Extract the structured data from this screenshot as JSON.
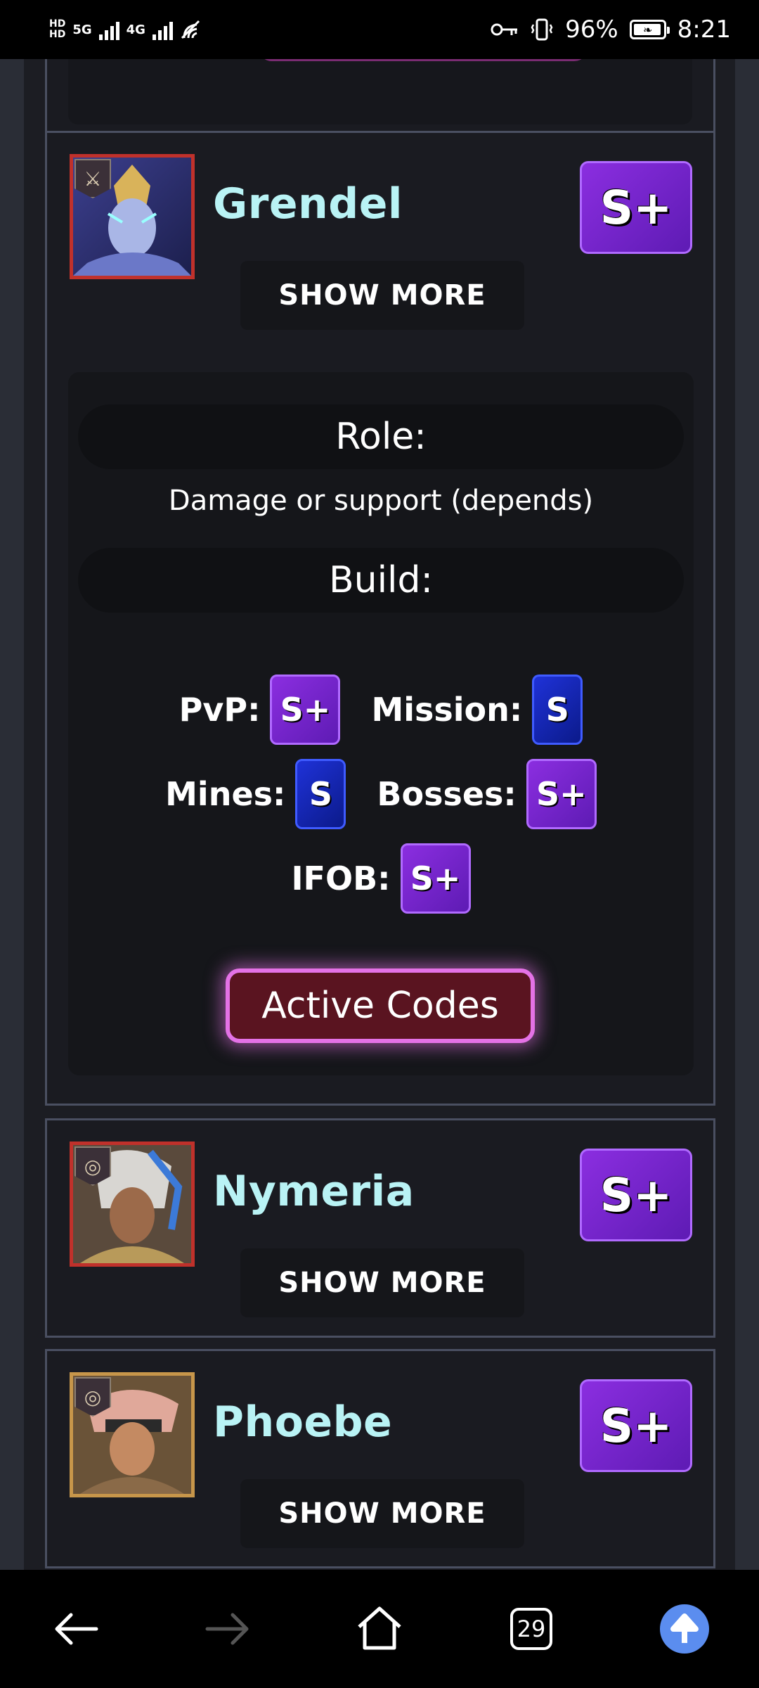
{
  "status_bar": {
    "hd_labels": [
      "HD",
      "HD"
    ],
    "network_5g": "5G",
    "network_4g": "4G",
    "battery_percent": "96%",
    "time": "8:21",
    "icons": [
      "key-icon",
      "vibrate-icon",
      "battery-saver-icon",
      "signal-icon",
      "wifi-off-icon"
    ]
  },
  "heroes": [
    {
      "name": "Grendel",
      "tier": "S+",
      "show_more_label": "SHOW MORE",
      "expanded": true,
      "role_heading": "Role:",
      "role_text": "Damage or support (depends)",
      "build_heading": "Build:",
      "ratings": [
        {
          "label": "PvP:",
          "tier": "S+"
        },
        {
          "label": "Mission:",
          "tier": "S"
        },
        {
          "label": "Mines:",
          "tier": "S"
        },
        {
          "label": "Bosses:",
          "tier": "S+"
        },
        {
          "label": "IFOB:",
          "tier": "S+"
        }
      ],
      "cta_label": "Active Codes"
    },
    {
      "name": "Nymeria",
      "tier": "S+",
      "show_more_label": "SHOW MORE"
    },
    {
      "name": "Phoebe",
      "tier": "S+",
      "show_more_label": "SHOW MORE"
    }
  ],
  "nav": {
    "tab_count": "29",
    "icons": [
      "back-arrow-icon",
      "forward-arrow-icon",
      "home-icon",
      "tabs-icon",
      "scroll-up-icon"
    ]
  },
  "colors": {
    "hero_name": "#b9f3f5",
    "tier_splus": "#7a26d0",
    "tier_s": "#1b2bd0",
    "cta_border": "#e472e6",
    "cta_bg": "#5a1420"
  }
}
